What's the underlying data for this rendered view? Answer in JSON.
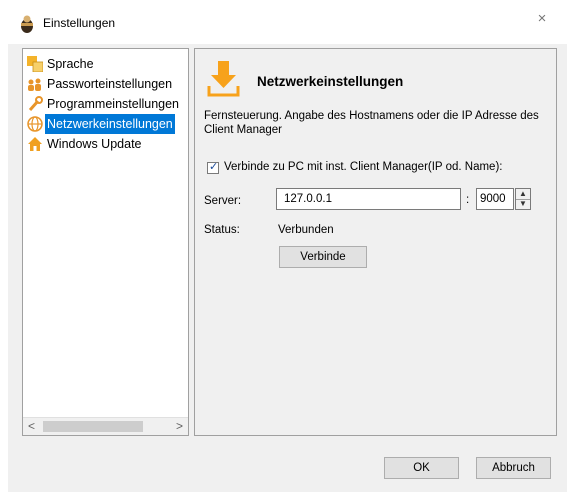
{
  "window": {
    "title": "Einstellungen",
    "close_label": "×"
  },
  "sidebar": {
    "items": [
      {
        "label": "Sprache",
        "icon": "language-icon",
        "selected": false
      },
      {
        "label": "Passworteinstellungen",
        "icon": "users-icon",
        "selected": false
      },
      {
        "label": "Programmeinstellungen",
        "icon": "wrench-icon",
        "selected": false
      },
      {
        "label": "Netzwerkeinstellungen",
        "icon": "globe-icon",
        "selected": true
      },
      {
        "label": "Windows Update",
        "icon": "home-icon",
        "selected": false
      }
    ],
    "scroll_left": "<",
    "scroll_right": ">"
  },
  "panel": {
    "title": "Netzwerkeinstellungen",
    "header_icon": "download-arrow-icon",
    "description": "Fernsteuerung. Angabe des Hostnamens oder die IP Adresse des Client Manager",
    "checkbox_label": "Verbinde zu PC mit inst. Client Manager(IP od. Name):",
    "checkbox_checked": true,
    "server_label": "Server:",
    "server_value": "127.0.0.1",
    "colon": ":",
    "port_value": "9000",
    "status_label": "Status:",
    "status_value": "Verbunden",
    "connect_button": "Verbinde"
  },
  "footer": {
    "ok_label": "OK",
    "cancel_label": "Abbruch"
  },
  "colors": {
    "selection": "#0078d7",
    "dialog_bg": "#f0f0f0",
    "icon_orange": "#f7a21b"
  }
}
